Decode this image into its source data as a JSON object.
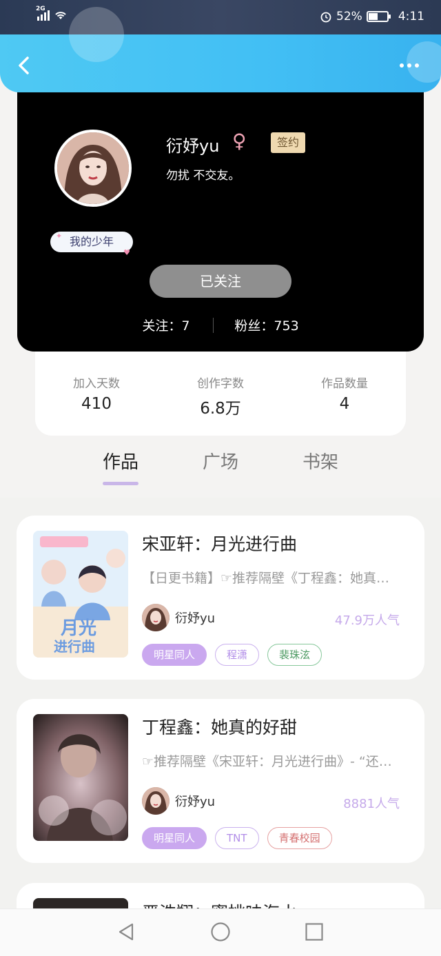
{
  "status_bar": {
    "network": "2G",
    "battery": "52%",
    "battery_level": 0.52,
    "time": "4:11"
  },
  "header": {
    "back_icon": "chevron-left-icon",
    "more_icon": "more-dots-icon",
    "accent_color": "#42bff4"
  },
  "profile": {
    "username": "衍妤yu",
    "gender_icon": "female-symbol-icon",
    "signed_badge": "签约",
    "bio": "勿扰 不交友。",
    "tag": "我的少年",
    "follow_button": "已关注",
    "following_text": "关注：7",
    "followers_text": "粉丝：753"
  },
  "stats": [
    {
      "label": "加入天数",
      "value": "410"
    },
    {
      "label": "创作字数",
      "value": "6.8万"
    },
    {
      "label": "作品数量",
      "value": "4"
    }
  ],
  "tabs": [
    {
      "label": "作品",
      "active": true
    },
    {
      "label": "广场",
      "active": false
    },
    {
      "label": "书架",
      "active": false
    }
  ],
  "works": [
    {
      "title": "宋亚轩：月光进行曲",
      "description": "【日更书籍】☞推荐隔壁《丁程鑫：她真…",
      "author": "衍妤yu",
      "popularity": "47.9万人气",
      "tags": [
        {
          "label": "明星同人",
          "style": "filled"
        },
        {
          "label": "程潇",
          "style": "purple"
        },
        {
          "label": "裴珠泫",
          "style": "green"
        }
      ]
    },
    {
      "title": "丁程鑫：她真的好甜",
      "description": "☞推荐隔壁《宋亚轩：月光进行曲》- “还…",
      "author": "衍妤yu",
      "popularity": "8881人气",
      "tags": [
        {
          "label": "明星同人",
          "style": "filled"
        },
        {
          "label": "TNT",
          "style": "purple"
        },
        {
          "label": "青春校园",
          "style": "red"
        }
      ]
    }
  ],
  "partial_work": {
    "title": "严浩翔：蜜桃味海水"
  },
  "nav": {
    "back": "triangle-back-icon",
    "home": "circle-home-icon",
    "recents": "square-recents-icon"
  }
}
